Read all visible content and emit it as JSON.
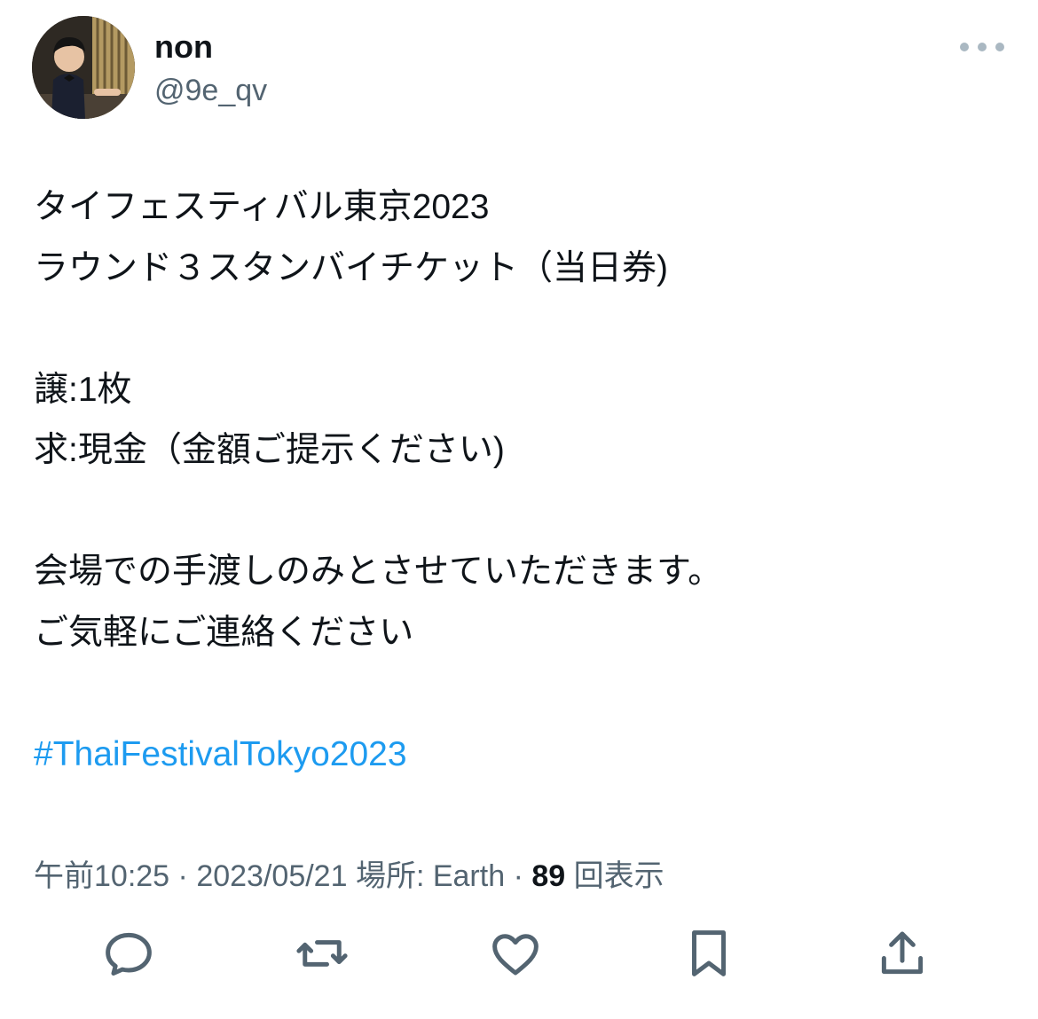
{
  "user": {
    "display_name": "non",
    "handle": "@9e_qv",
    "avatar_icon": "user-avatar"
  },
  "body_lines": [
    "タイフェスティバル東京2023",
    "ラウンド３スタンバイチケット（当日券)",
    "",
    "譲:1枚",
    "求:現金（金額ご提示ください)",
    "",
    "会場での手渡しのみとさせていただきます。",
    "ご気軽にご連絡ください",
    ""
  ],
  "hashtag": "#ThaiFestivalTokyo2023",
  "meta": {
    "time": "午前10:25",
    "separator": "·",
    "date": "2023/05/21",
    "location_label": "場所: Earth",
    "view_count": "89",
    "view_label": "回表示"
  },
  "actions": [
    "reply-icon",
    "retweet-icon",
    "like-icon",
    "bookmark-icon",
    "share-icon"
  ],
  "colors": {
    "text": "#0f1419",
    "secondary": "#536471",
    "link": "#1d9bf0",
    "icon": "#536471"
  }
}
